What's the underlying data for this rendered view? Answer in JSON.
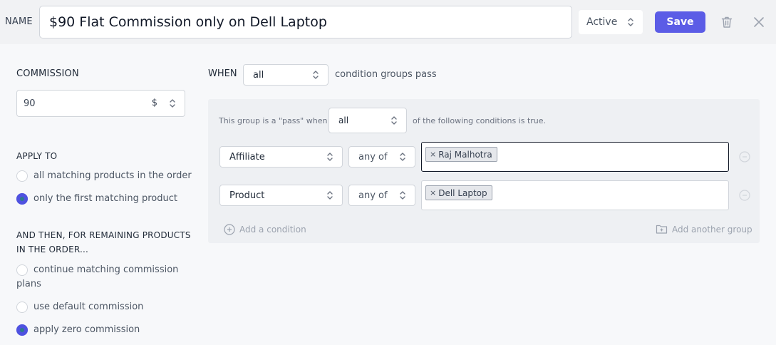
{
  "header": {
    "name_label": "NAME",
    "name_value": "$90 Flat Commission only on Dell Laptop",
    "status": "Active",
    "save_label": "Save"
  },
  "commission": {
    "label": "COMMISSION",
    "value": "90",
    "unit": "$"
  },
  "apply_to": {
    "label": "APPLY TO",
    "options": [
      {
        "label": "all matching products in the order",
        "checked": false
      },
      {
        "label": "only the first matching product",
        "checked": true
      }
    ]
  },
  "remaining": {
    "label_line1": "AND THEN, FOR REMAINING PRODUCTS",
    "label_line2": "IN THE ORDER...",
    "options": [
      {
        "label_line1": "continue matching commission",
        "label_line2": "plans",
        "checked": false
      },
      {
        "label_line1": "use default commission",
        "checked": false
      },
      {
        "label_line1": "apply zero commission",
        "checked": true
      }
    ]
  },
  "when": {
    "label": "WHEN",
    "value": "all",
    "suffix": "condition groups pass"
  },
  "group": {
    "prefix": "This group is a \"pass\" when",
    "value": "all",
    "suffix": "of the following conditions is true.",
    "conditions": [
      {
        "field": "Affiliate",
        "operator": "any of",
        "tag": "Raj Malhotra"
      },
      {
        "field": "Product",
        "operator": "any of",
        "tag": "Dell Laptop"
      }
    ],
    "add_condition": "Add a condition",
    "add_group": "Add another group"
  },
  "icons": {
    "chevron": "chevron-up-down-icon",
    "trash": "trash-icon",
    "close": "close-icon",
    "remove": "minus-circle-icon",
    "add": "plus-circle-icon",
    "folder_add": "folder-plus-icon"
  },
  "colors": {
    "primary": "#5b5ce6",
    "radio_checked": "#4f52e0"
  }
}
